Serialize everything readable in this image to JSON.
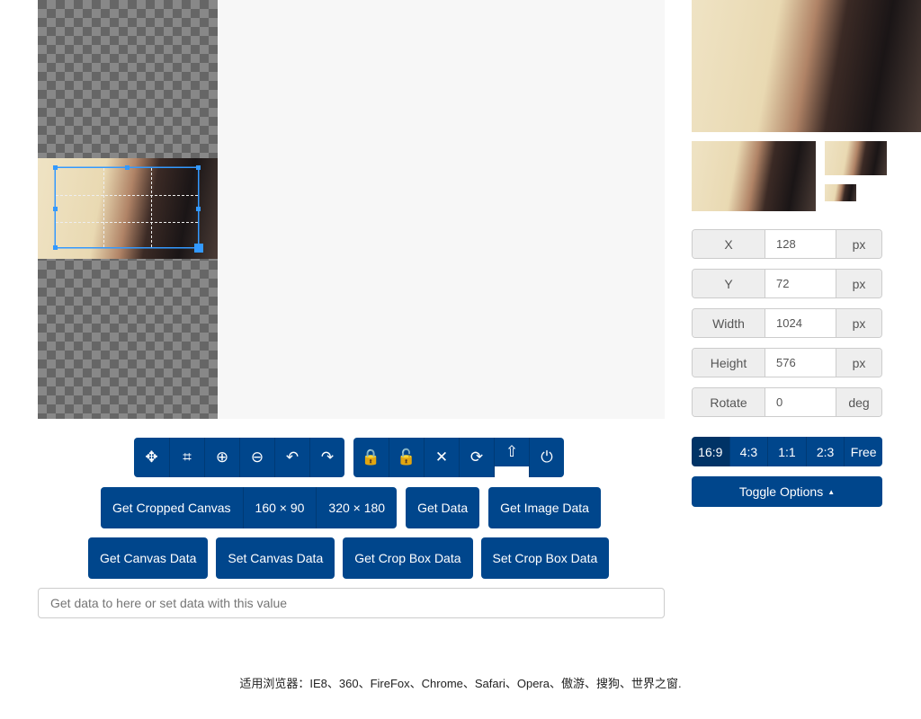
{
  "toolbar": {
    "group1": [
      {
        "name": "move-icon",
        "glyph": "✥"
      },
      {
        "name": "crop-icon",
        "glyph": "⌗"
      },
      {
        "name": "zoom-in-icon",
        "glyph": "⊕"
      },
      {
        "name": "zoom-out-icon",
        "glyph": "⊖"
      },
      {
        "name": "rotate-left-icon",
        "glyph": "↶"
      },
      {
        "name": "rotate-right-icon",
        "glyph": "↷"
      }
    ],
    "group2": [
      {
        "name": "lock-icon",
        "glyph": "🔒"
      },
      {
        "name": "unlock-icon",
        "glyph": "🔓"
      },
      {
        "name": "close-icon",
        "glyph": "✕"
      },
      {
        "name": "reset-icon",
        "glyph": "⟳"
      },
      {
        "name": "upload-icon",
        "glyph": "⇧"
      },
      {
        "name": "power-icon",
        "glyph": "⏻"
      }
    ]
  },
  "buttons": {
    "get_cropped_canvas": "Get Cropped Canvas",
    "size1": "160 × 90",
    "size2": "320 × 180",
    "get_data": "Get Data",
    "get_image_data": "Get Image Data",
    "get_canvas_data": "Get Canvas Data",
    "set_canvas_data": "Set Canvas Data",
    "get_crop_box_data": "Get Crop Box Data",
    "set_crop_box_data": "Set Crop Box Data"
  },
  "data_input": {
    "placeholder": "Get data to here or set data with this value"
  },
  "fields": [
    {
      "label": "X",
      "value": "128",
      "unit": "px"
    },
    {
      "label": "Y",
      "value": "72",
      "unit": "px"
    },
    {
      "label": "Width",
      "value": "1024",
      "unit": "px"
    },
    {
      "label": "Height",
      "value": "576",
      "unit": "px"
    },
    {
      "label": "Rotate",
      "value": "0",
      "unit": "deg"
    }
  ],
  "ratios": [
    "16:9",
    "4:3",
    "1:1",
    "2:3",
    "Free"
  ],
  "active_ratio": "16:9",
  "toggle_options": "Toggle Options",
  "footer": "适用浏览器：IE8、360、FireFox、Chrome、Safari、Opera、傲游、搜狗、世界之窗.",
  "colors": {
    "primary": "#00468c",
    "active": "#003366"
  }
}
